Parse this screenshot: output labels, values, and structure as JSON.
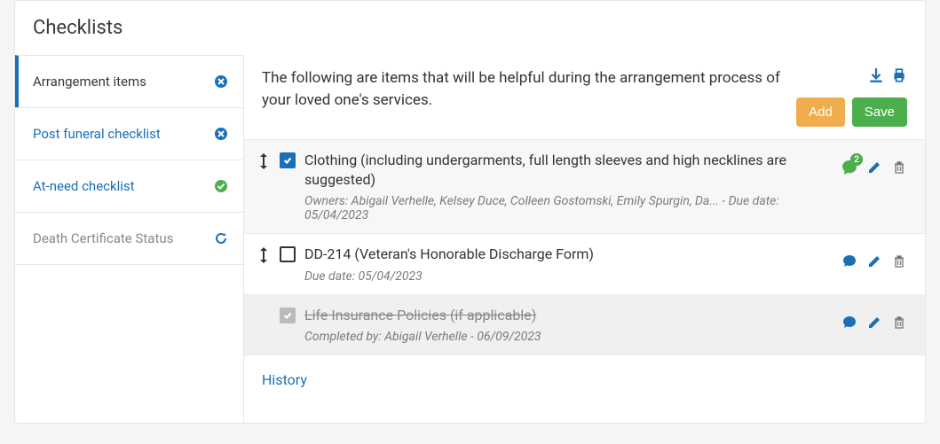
{
  "title": "Checklists",
  "sidebar": {
    "items": [
      {
        "label": "Arrangement items",
        "active": true,
        "icon": "remove"
      },
      {
        "label": "Post funeral checklist",
        "active": false,
        "icon": "remove"
      },
      {
        "label": "At-need checklist",
        "active": false,
        "icon": "check"
      },
      {
        "label": "Death Certificate Status",
        "active": false,
        "icon": "refresh"
      }
    ]
  },
  "description": "The following are items that will be helpful during the arrangement process of your loved one's services.",
  "buttons": {
    "add": "Add",
    "save": "Save"
  },
  "items": [
    {
      "title": "Clothing (including undergarments, full length sleeves and high necklines are suggested)",
      "meta": "Owners: Abigail Verhelle, Kelsey Duce, Colleen Gostomski, Emily Spurgin, Da... - Due date: 05/04/2023",
      "checked": true,
      "draggable": true,
      "shaded": true,
      "comment_count": "2",
      "comment_style": "whatsapp"
    },
    {
      "title": "DD-214 (Veteran's Honorable Discharge Form)",
      "meta": "Due date: 05/04/2023",
      "checked": false,
      "draggable": true,
      "shaded": false,
      "comment_style": "plain"
    },
    {
      "title": "Life Insurance Policies (if applicable)",
      "meta": "Completed by: Abigail Verhelle - 06/09/2023",
      "checked": true,
      "completed": true,
      "draggable": false,
      "shaded": true,
      "comment_style": "plain"
    }
  ],
  "history_label": "History",
  "colors": {
    "link": "#1a6fb5",
    "success": "#4cae4c",
    "warn": "#f0ad4e",
    "muted": "#888"
  }
}
